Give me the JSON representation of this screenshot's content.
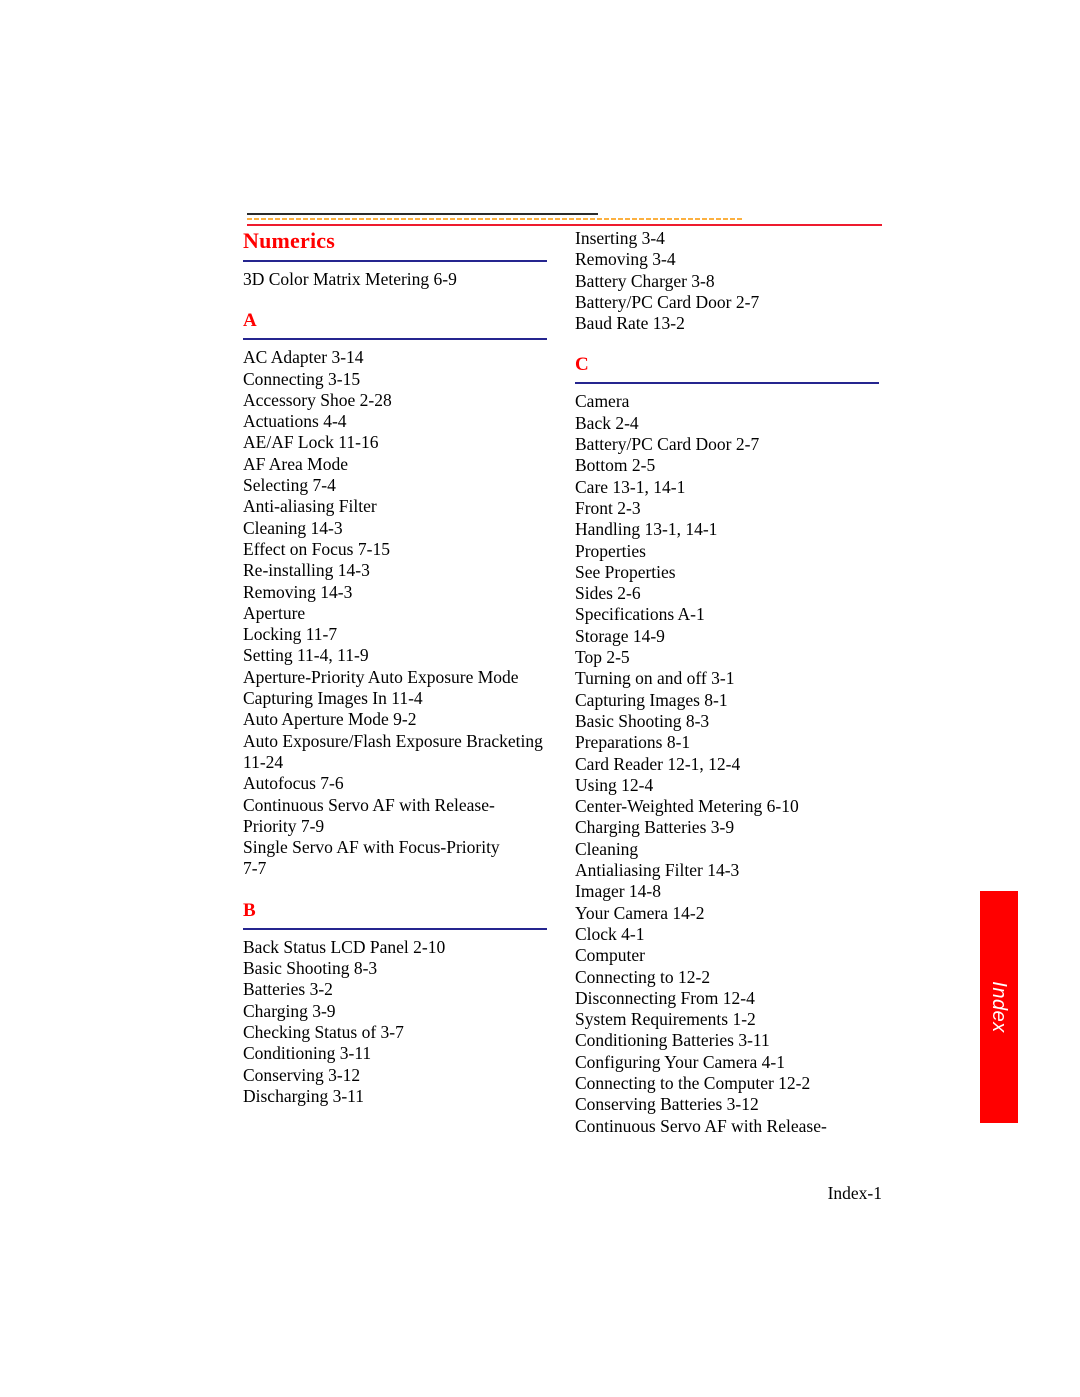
{
  "document": {
    "type": "index",
    "footer_page_label": "Index-1",
    "side_tab_label": "Index",
    "colors": {
      "section_head": "#ff0000",
      "section_underline": "#25258f",
      "rule_dark": "#2b2b2b",
      "rule_yellow": "#fcb040",
      "rule_red": "#ee1b2e",
      "tab_background": "#ff0000",
      "tab_text": "#ffffff",
      "body_text": "#000000"
    }
  },
  "columns": [
    {
      "name": "left-column",
      "sections": [
        {
          "head": "Numerics",
          "entries": [
            {
              "level": 0,
              "text": "3D Color Matrix Metering 6-9"
            }
          ]
        },
        {
          "head": "A",
          "entries": [
            {
              "level": 0,
              "text": "AC Adapter 3-14"
            },
            {
              "level": 1,
              "text": "Connecting 3-15"
            },
            {
              "level": 0,
              "text": "Accessory Shoe 2-28"
            },
            {
              "level": 0,
              "text": "Actuations 4-4"
            },
            {
              "level": 0,
              "text": "AE/AF Lock 11-16"
            },
            {
              "level": 0,
              "text": "AF Area Mode"
            },
            {
              "level": 1,
              "text": "Selecting 7-4"
            },
            {
              "level": 0,
              "text": "Anti-aliasing Filter"
            },
            {
              "level": 1,
              "text": "Cleaning 14-3"
            },
            {
              "level": 1,
              "text": "Effect on Focus 7-15"
            },
            {
              "level": 1,
              "text": "Re-installing 14-3"
            },
            {
              "level": 1,
              "text": "Removing 14-3"
            },
            {
              "level": 0,
              "text": "Aperture"
            },
            {
              "level": 1,
              "text": "Locking 11-7"
            },
            {
              "level": 1,
              "text": "Setting 11-4, 11-9"
            },
            {
              "level": 0,
              "text": "Aperture-Priority Auto Exposure Mode"
            },
            {
              "level": 1,
              "text": "Capturing Images In 11-4"
            },
            {
              "level": 0,
              "text": "Auto Aperture Mode 9-2"
            },
            {
              "level": 0,
              "text": "Auto Exposure/Flash Exposure Bracketing"
            },
            {
              "level": 2,
              "text": "11-24"
            },
            {
              "level": 0,
              "text": "Autofocus 7-6"
            },
            {
              "level": 1,
              "text": "Continuous Servo AF with Release-"
            },
            {
              "level": 2,
              "text": "Priority 7-9"
            },
            {
              "level": 1,
              "text": "Single Servo AF with Focus-Priority"
            },
            {
              "level": 2,
              "text": "7-7"
            }
          ]
        },
        {
          "head": "B",
          "entries": [
            {
              "level": 0,
              "text": "Back Status LCD Panel 2-10"
            },
            {
              "level": 0,
              "text": "Basic Shooting 8-3"
            },
            {
              "level": 0,
              "text": "Batteries 3-2"
            },
            {
              "level": 1,
              "text": "Charging 3-9"
            },
            {
              "level": 1,
              "text": "Checking Status of 3-7"
            },
            {
              "level": 1,
              "text": "Conditioning 3-11"
            },
            {
              "level": 1,
              "text": "Conserving 3-12"
            },
            {
              "level": 1,
              "text": "Discharging 3-11"
            }
          ]
        }
      ]
    },
    {
      "name": "right-column",
      "sections": [
        {
          "head": null,
          "entries": [
            {
              "level": 1,
              "text": "Inserting 3-4"
            },
            {
              "level": 1,
              "text": "Removing 3-4"
            },
            {
              "level": 0,
              "text": "Battery Charger 3-8"
            },
            {
              "level": 0,
              "text": "Battery/PC Card Door 2-7"
            },
            {
              "level": 0,
              "text": "Baud Rate 13-2"
            }
          ]
        },
        {
          "head": "C",
          "entries": [
            {
              "level": 0,
              "text": "Camera"
            },
            {
              "level": 1,
              "text": "Back 2-4"
            },
            {
              "level": 1,
              "text": "Battery/PC Card Door 2-7"
            },
            {
              "level": 1,
              "text": "Bottom 2-5"
            },
            {
              "level": 1,
              "text": "Care 13-1, 14-1"
            },
            {
              "level": 1,
              "text": "Front 2-3"
            },
            {
              "level": 1,
              "text": "Handling 13-1, 14-1"
            },
            {
              "level": 1,
              "text": "Properties"
            },
            {
              "level": 2,
              "text": "See Properties"
            },
            {
              "level": 1,
              "text": "Sides 2-6"
            },
            {
              "level": 1,
              "text": "Specifications A-1"
            },
            {
              "level": 1,
              "text": "Storage 14-9"
            },
            {
              "level": 1,
              "text": "Top 2-5"
            },
            {
              "level": 1,
              "text": "Turning on and off 3-1"
            },
            {
              "level": 0,
              "text": "Capturing Images 8-1"
            },
            {
              "level": 1,
              "text": "Basic Shooting 8-3"
            },
            {
              "level": 1,
              "text": "Preparations 8-1"
            },
            {
              "level": 0,
              "text": "Card Reader 12-1, 12-4"
            },
            {
              "level": 1,
              "text": "Using 12-4"
            },
            {
              "level": 0,
              "text": "Center-Weighted Metering 6-10"
            },
            {
              "level": 0,
              "text": "Charging Batteries 3-9"
            },
            {
              "level": 0,
              "text": "Cleaning"
            },
            {
              "level": 1,
              "text": "Antialiasing Filter 14-3"
            },
            {
              "level": 1,
              "text": "Imager 14-8"
            },
            {
              "level": 1,
              "text": "Your Camera 14-2"
            },
            {
              "level": 0,
              "text": "Clock 4-1"
            },
            {
              "level": 0,
              "text": "Computer"
            },
            {
              "level": 1,
              "text": "Connecting to 12-2"
            },
            {
              "level": 1,
              "text": "Disconnecting From 12-4"
            },
            {
              "level": 1,
              "text": "System Requirements 1-2"
            },
            {
              "level": 0,
              "text": "Conditioning Batteries 3-11"
            },
            {
              "level": 0,
              "text": "Configuring Your Camera 4-1"
            },
            {
              "level": 0,
              "text": "Connecting to the Computer 12-2"
            },
            {
              "level": 0,
              "text": "Conserving Batteries 3-12"
            },
            {
              "level": 0,
              "text": "Continuous Servo AF with Release-"
            }
          ]
        }
      ]
    }
  ]
}
